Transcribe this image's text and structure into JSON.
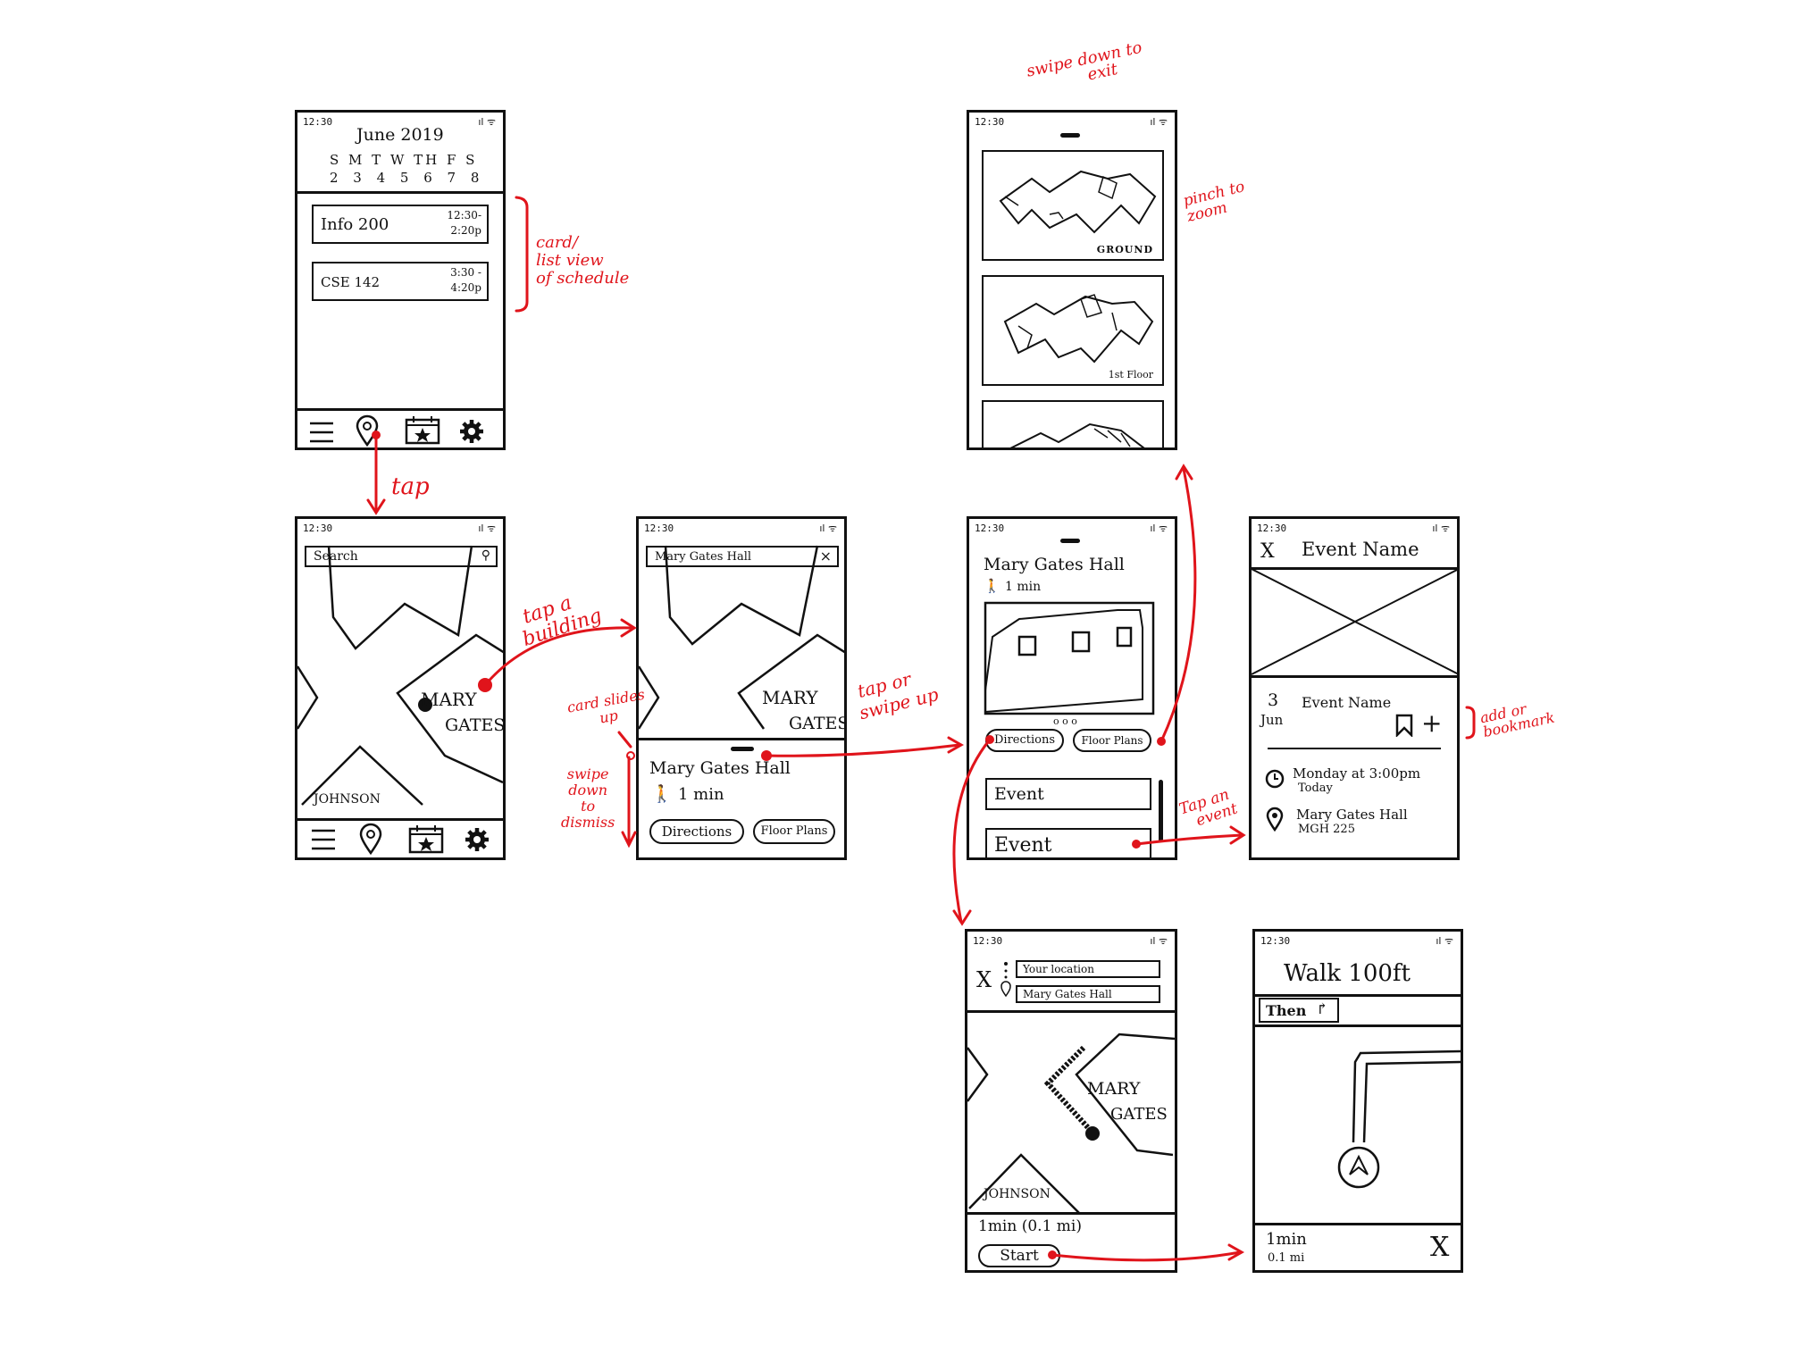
{
  "status": {
    "time": "12:30",
    "signal": "ıl ᯤ"
  },
  "screen1": {
    "month": "June 2019",
    "weekdays": "S M T W TH F S",
    "dates": "2 3 4 5 6 7 8",
    "cards": [
      {
        "name": "Info 200",
        "time1": "12:30-",
        "time2": "2:20p"
      },
      {
        "name": "CSE 142",
        "time1": "3:30 -",
        "time2": "4:20p"
      }
    ]
  },
  "screen2": {
    "search_placeholder": "Search",
    "building_label_1": "MARY",
    "building_label_2": "GATES",
    "johnson_label": "JOHNSON"
  },
  "screen3": {
    "search_value": "Mary Gates Hall",
    "close_glyph": "×",
    "building_label_1": "MARY",
    "building_label_2": "GATES",
    "card_title": "Mary Gates Hall",
    "walk_time": "1 min",
    "directions_label": "Directions",
    "floor_plans_label": "Floor Plans"
  },
  "screen4": {
    "title": "Mary Gates Hall",
    "walk_time": "1 min",
    "pager_dots": "o o o",
    "directions_label": "Directions",
    "floor_plans_label": "Floor Plans",
    "events": [
      "Event",
      "Event"
    ]
  },
  "screen5": {
    "floors": [
      "GROUND",
      "1st Floor"
    ]
  },
  "screen6": {
    "close_glyph": "X",
    "title": "Event Name",
    "day": "3",
    "month": "Jun",
    "event_name": "Event Name",
    "plus": "+",
    "time_line1": "Monday at 3:00pm",
    "time_line2": "Today",
    "place_line1": "Mary Gates Hall",
    "place_line2": "MGH 225"
  },
  "screen7": {
    "close_glyph": "X",
    "from": "Your location",
    "to": "Mary Gates Hall",
    "building_label_1": "MARY",
    "building_label_2": "GATES",
    "johnson_label": "JOHNSON",
    "summary": "1min (0.1 mi)",
    "start_label": "Start"
  },
  "screen8": {
    "instruction": "Walk 100ft",
    "then_label": "Then",
    "eta": "1min",
    "distance": "0.1 mi",
    "close_glyph": "X"
  },
  "annotations": {
    "tap": "tap",
    "card_list": [
      "card/",
      "list view",
      "of schedule"
    ],
    "tap_building": [
      "tap a",
      "building"
    ],
    "card_slides": [
      "card slides",
      "up"
    ],
    "swipe_dismiss": [
      "swipe",
      "down",
      "to",
      "dismiss"
    ],
    "tap_swipe": [
      "tap or",
      "swipe up"
    ],
    "swipe_exit": [
      "swipe down to",
      "exit"
    ],
    "pinch_zoom": [
      "pinch to",
      "zoom"
    ],
    "tap_event": [
      "Tap an",
      "event"
    ],
    "add_bookmark": [
      "add or",
      "bookmark"
    ]
  },
  "colors": {
    "ink": "#111111",
    "annotation": "#e0141b"
  }
}
